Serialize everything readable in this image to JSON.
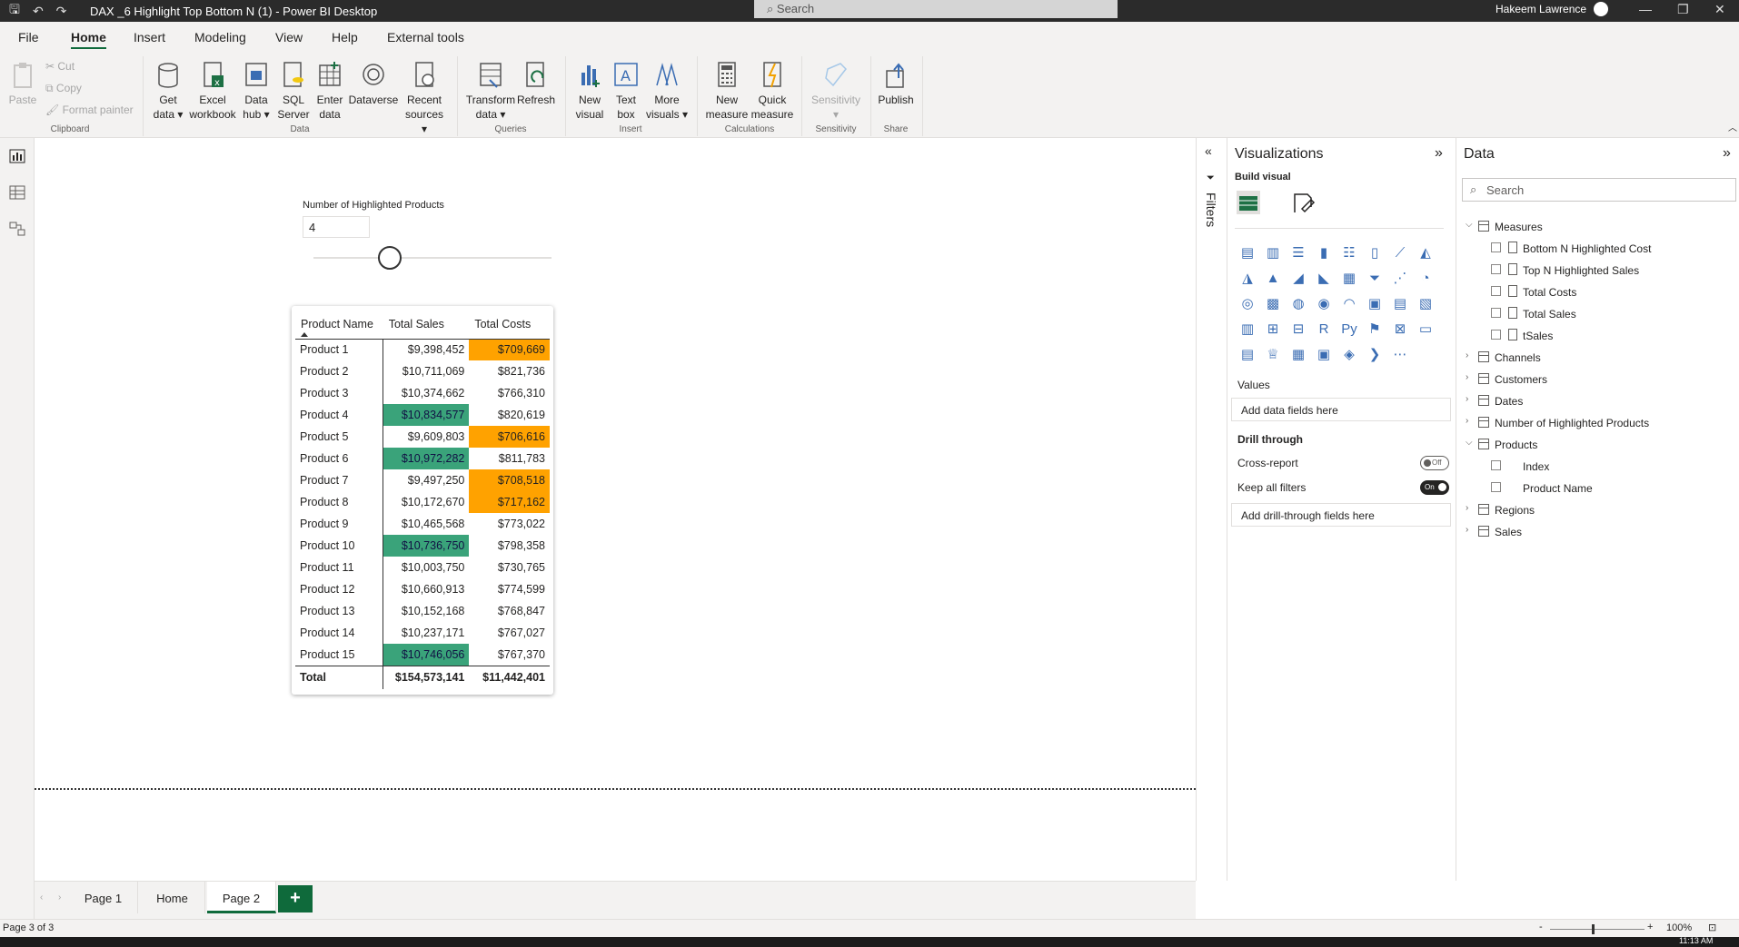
{
  "window": {
    "title": "DAX _6 Highlight Top Bottom N (1) - Power BI Desktop",
    "search_placeholder": "Search",
    "user": "Hakeem Lawrence"
  },
  "ribbon_tabs": [
    "File",
    "Home",
    "Insert",
    "Modeling",
    "View",
    "Help",
    "External tools"
  ],
  "ribbon": {
    "clipboard": {
      "paste": "Paste",
      "cut": "Cut",
      "copy": "Copy",
      "format_painter": "Format painter",
      "group": "Clipboard"
    },
    "data": {
      "get_data": [
        "Get",
        "data ▾"
      ],
      "excel": [
        "Excel",
        "workbook"
      ],
      "data_hub": [
        "Data",
        "hub ▾"
      ],
      "sql": [
        "SQL",
        "Server"
      ],
      "enter": [
        "Enter",
        "data"
      ],
      "dataverse": [
        "Dataverse",
        ""
      ],
      "recent": [
        "Recent",
        "sources ▾"
      ],
      "group": "Data"
    },
    "queries": {
      "transform": [
        "Transform",
        "data ▾"
      ],
      "refresh": [
        "Refresh",
        ""
      ],
      "group": "Queries"
    },
    "insert": {
      "new_visual": [
        "New",
        "visual"
      ],
      "text_box": [
        "Text",
        "box"
      ],
      "more_visuals": [
        "More",
        "visuals ▾"
      ],
      "group": "Insert"
    },
    "calculations": {
      "new_measure": [
        "New",
        "measure"
      ],
      "quick_measure": [
        "Quick",
        "measure"
      ],
      "group": "Calculations"
    },
    "sensitivity": {
      "label": [
        "Sensitivity",
        "▾"
      ],
      "group": "Sensitivity"
    },
    "share": {
      "publish": [
        "Publish",
        ""
      ],
      "group": "Share"
    }
  },
  "slicer": {
    "title": "Number of Highlighted Products",
    "value": "4",
    "level_fraction": 0.32
  },
  "table": {
    "headers": [
      "Product Name",
      "Total Sales",
      "Total Costs"
    ],
    "rows": [
      {
        "name": "Product 1",
        "sales": "$9,398,452",
        "costs": "$709,669",
        "sales_hl": "",
        "costs_hl": "bottom"
      },
      {
        "name": "Product 2",
        "sales": "$10,711,069",
        "costs": "$821,736",
        "sales_hl": "",
        "costs_hl": ""
      },
      {
        "name": "Product 3",
        "sales": "$10,374,662",
        "costs": "$766,310",
        "sales_hl": "",
        "costs_hl": ""
      },
      {
        "name": "Product 4",
        "sales": "$10,834,577",
        "costs": "$820,619",
        "sales_hl": "top",
        "costs_hl": ""
      },
      {
        "name": "Product 5",
        "sales": "$9,609,803",
        "costs": "$706,616",
        "sales_hl": "",
        "costs_hl": "bottom"
      },
      {
        "name": "Product 6",
        "sales": "$10,972,282",
        "costs": "$811,783",
        "sales_hl": "top",
        "costs_hl": ""
      },
      {
        "name": "Product 7",
        "sales": "$9,497,250",
        "costs": "$708,518",
        "sales_hl": "",
        "costs_hl": "bottom"
      },
      {
        "name": "Product 8",
        "sales": "$10,172,670",
        "costs": "$717,162",
        "sales_hl": "",
        "costs_hl": "bottom"
      },
      {
        "name": "Product 9",
        "sales": "$10,465,568",
        "costs": "$773,022",
        "sales_hl": "",
        "costs_hl": ""
      },
      {
        "name": "Product 10",
        "sales": "$10,736,750",
        "costs": "$798,358",
        "sales_hl": "top",
        "costs_hl": ""
      },
      {
        "name": "Product 11",
        "sales": "$10,003,750",
        "costs": "$730,765",
        "sales_hl": "",
        "costs_hl": ""
      },
      {
        "name": "Product 12",
        "sales": "$10,660,913",
        "costs": "$774,599",
        "sales_hl": "",
        "costs_hl": ""
      },
      {
        "name": "Product 13",
        "sales": "$10,152,168",
        "costs": "$768,847",
        "sales_hl": "",
        "costs_hl": ""
      },
      {
        "name": "Product 14",
        "sales": "$10,237,171",
        "costs": "$767,027",
        "sales_hl": "",
        "costs_hl": ""
      },
      {
        "name": "Product 15",
        "sales": "$10,746,056",
        "costs": "$767,370",
        "sales_hl": "top",
        "costs_hl": ""
      }
    ],
    "total": {
      "label": "Total",
      "sales": "$154,573,141",
      "costs": "$11,442,401"
    },
    "colors": {
      "top": "#3aa37a",
      "bottom": "#ffa200"
    }
  },
  "page_tabs": [
    "Page 1",
    "Home",
    "Page 2"
  ],
  "active_page": "Page 2",
  "status": {
    "page": "Page 3 of 3",
    "zoom": "100%"
  },
  "filters_label": "Filters",
  "visualizations": {
    "title": "Visualizations",
    "build_visual": "Build visual",
    "icons": [
      "▤",
      "▥",
      "☰",
      "▮",
      "☷",
      "▯",
      "⟋",
      "◭",
      "◮",
      "▲",
      "◢",
      "◣",
      "▦",
      "⏷",
      "⋰",
      "◔",
      "◎",
      "▩",
      "◍",
      "◉",
      "◠",
      "▣",
      "▤",
      "▧",
      "▥",
      "⊞",
      "⊟",
      "R",
      "Py",
      "⚑",
      "⊠",
      "▭",
      "▤",
      "♕",
      "▦",
      "▣",
      "◈",
      "❯",
      "⋯"
    ],
    "values_label": "Values",
    "values_placeholder": "Add data fields here",
    "drill_through": "Drill through",
    "cross_report": "Cross-report",
    "cross_report_state": "Off",
    "keep_all_filters": "Keep all filters",
    "keep_all_filters_state": "On",
    "drill_placeholder": "Add drill-through fields here"
  },
  "data_pane": {
    "title": "Data",
    "search_placeholder": "Search",
    "tables": [
      {
        "name": "Measures",
        "expanded": true,
        "fields": [
          "Bottom N Highlighted Cost",
          "Top N Highlighted Sales",
          "Total Costs",
          "Total Sales",
          "tSales"
        ]
      },
      {
        "name": "Channels",
        "expanded": false,
        "fields": []
      },
      {
        "name": "Customers",
        "expanded": false,
        "fields": []
      },
      {
        "name": "Dates",
        "expanded": false,
        "fields": []
      },
      {
        "name": "Number of Highlighted Products",
        "expanded": false,
        "fields": []
      },
      {
        "name": "Products",
        "expanded": true,
        "fields": [
          "Index",
          "Product Name"
        ]
      },
      {
        "name": "Regions",
        "expanded": false,
        "fields": []
      },
      {
        "name": "Sales",
        "expanded": false,
        "fields": []
      }
    ]
  },
  "taskbar_time": "11:13 AM"
}
